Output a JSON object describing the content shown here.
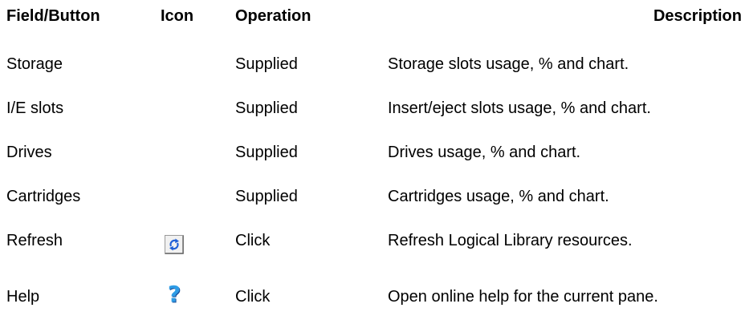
{
  "header": {
    "field": "Field/Button",
    "icon": "Icon",
    "operation": "Operation",
    "description": "Description"
  },
  "rows": [
    {
      "field": "Storage",
      "operation": "Supplied",
      "description": "Storage slots usage, % and chart."
    },
    {
      "field": "I/E slots",
      "operation": "Supplied",
      "description": "Insert/eject slots usage, % and chart."
    },
    {
      "field": "Drives",
      "operation": "Supplied",
      "description": "Drives usage, % and chart."
    },
    {
      "field": "Cartridges",
      "operation": "Supplied",
      "description": "Cartridges usage, % and chart."
    },
    {
      "field": "Refresh",
      "icon": "refresh-icon",
      "operation": "Click",
      "description": "Refresh Logical Library resources."
    },
    {
      "field": "Help",
      "icon": "help-icon",
      "operation": "Click",
      "description": "Open online help for the current pane."
    }
  ],
  "colors": {
    "refresh_icon_blue": "#1f5fd6",
    "help_icon_blue": "#2e9ce6"
  }
}
